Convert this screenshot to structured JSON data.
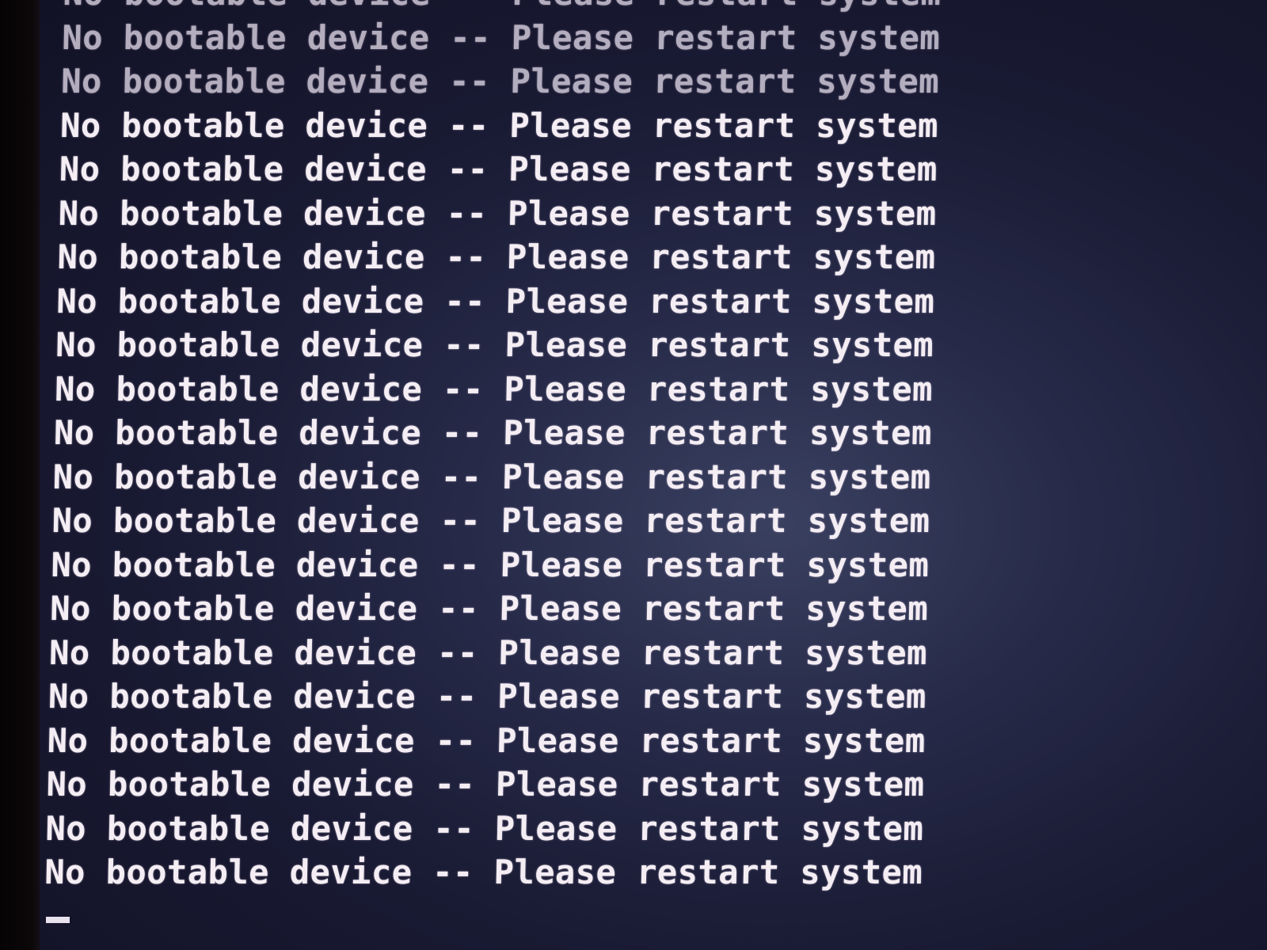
{
  "terminal": {
    "lines": [
      "No bootable device -- Please restart system",
      "No bootable device -- Please restart system",
      "No bootable device -- Please restart system",
      "No bootable device -- Please restart system",
      "No bootable device -- Please restart system",
      "No bootable device -- Please restart system",
      "No bootable device -- Please restart system",
      "No bootable device -- Please restart system",
      "No bootable device -- Please restart system",
      "No bootable device -- Please restart system",
      "No bootable device -- Please restart system",
      "No bootable device -- Please restart system",
      "No bootable device -- Please restart system",
      "No bootable device -- Please restart system",
      "No bootable device -- Please restart system",
      "No bootable device -- Please restart system",
      "No bootable device -- Please restart system",
      "No bootable device -- Please restart system",
      "No bootable device -- Please restart system",
      "No bootable device -- Please restart system",
      "No bootable device -- Please restart system"
    ],
    "cursor": "_"
  },
  "colors": {
    "text": "#f4eef4",
    "background": "#1c1f3a"
  }
}
